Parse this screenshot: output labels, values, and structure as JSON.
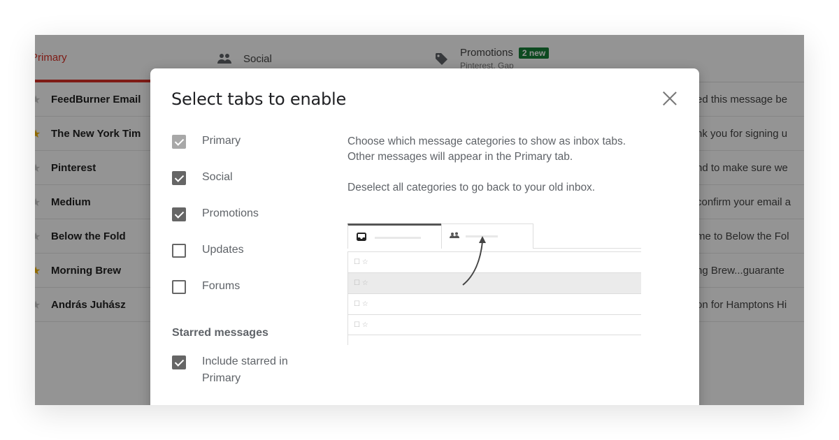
{
  "inbox": {
    "tabs": [
      {
        "label": "Primary",
        "icon": "inbox-icon",
        "active": true
      },
      {
        "label": "Social",
        "icon": "people-icon"
      },
      {
        "label": "Promotions",
        "icon": "tag-icon",
        "badge": "2 new",
        "subtitle": "Pinterest, Gap"
      }
    ],
    "messages": [
      {
        "sender": "FeedBurner Email",
        "starred": false,
        "snippet": "ed this message be"
      },
      {
        "sender": "The New York Tim",
        "starred": true,
        "snippet": "nk you for signing u"
      },
      {
        "sender": "Pinterest",
        "starred": false,
        "snippet": "nd to make sure we"
      },
      {
        "sender": "Medium",
        "starred": false,
        "snippet": "confirm your email a"
      },
      {
        "sender": "Below the Fold",
        "starred": false,
        "snippet": "me to Below the Fol"
      },
      {
        "sender": "Morning Brew",
        "starred": true,
        "snippet": "ng Brew...guarante"
      },
      {
        "sender": "András Juhász",
        "starred": false,
        "snippet": "on for Hamptons Hi"
      }
    ]
  },
  "dialog": {
    "title": "Select tabs to enable",
    "close_icon": "close-icon",
    "options": [
      {
        "label": "Primary",
        "checked": true,
        "disabled": true
      },
      {
        "label": "Social",
        "checked": true,
        "disabled": false
      },
      {
        "label": "Promotions",
        "checked": true,
        "disabled": false
      },
      {
        "label": "Updates",
        "checked": false,
        "disabled": false
      },
      {
        "label": "Forums",
        "checked": false,
        "disabled": false
      }
    ],
    "starred_heading": "Starred messages",
    "starred_option": {
      "label": "Include starred in Primary",
      "checked": true
    },
    "description": [
      "Choose which message categories to show as inbox tabs. Other messages will appear in the Primary tab.",
      "Deselect all categories to go back to your old inbox."
    ],
    "illustration": {
      "tab_icons": [
        "inbox-icon",
        "people-icon"
      ],
      "row_glyphs": "☐ ☆",
      "row_count": 4,
      "highlighted_row": 1
    }
  },
  "colors": {
    "primary_tab_accent": "#d93025",
    "badge_bg": "#188038",
    "star_on": "#f4b400"
  }
}
